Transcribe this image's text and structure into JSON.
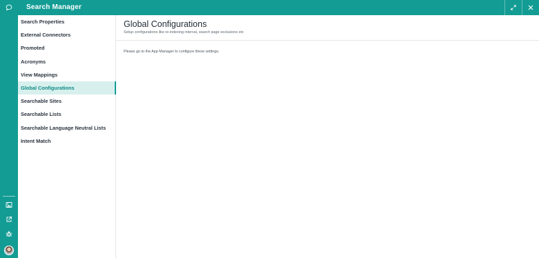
{
  "app": {
    "title": "Search Manager"
  },
  "rail": {
    "top_icon": "chat-bubble-icon",
    "bottom_icons": [
      "image-icon",
      "external-link-icon",
      "bug-icon"
    ],
    "avatar": "user-avatar"
  },
  "header": {
    "expand_icon": "expand-icon",
    "close_icon": "close-icon"
  },
  "sidebar": {
    "items": [
      {
        "label": "Search Properties",
        "active": false
      },
      {
        "label": "External Connectors",
        "active": false
      },
      {
        "label": "Promoted",
        "active": false
      },
      {
        "label": "Acronyms",
        "active": false
      },
      {
        "label": "View Mappings",
        "active": false
      },
      {
        "label": "Global Configurations",
        "active": true
      },
      {
        "label": "Searchable Sites",
        "active": false
      },
      {
        "label": "Searchable Lists",
        "active": false
      },
      {
        "label": "Searchable Language Neutral Lists",
        "active": false
      },
      {
        "label": "Intent Match",
        "active": false
      }
    ]
  },
  "main": {
    "title": "Global Configurations",
    "subtitle": "Setup configurations like re-indexing interval, search page exclusions etc",
    "message": "Please go to the App Manager to configure these settings."
  },
  "colors": {
    "accent": "#139c94",
    "active_bg": "#d7f0ee"
  }
}
